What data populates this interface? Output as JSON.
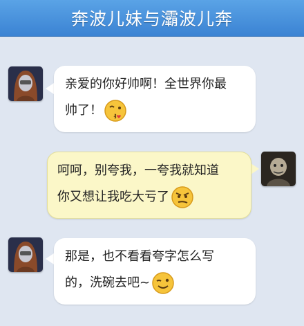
{
  "header": {
    "title": "奔波儿妹与灞波儿奔"
  },
  "messages": [
    {
      "side": "left",
      "lines": [
        "亲爱的你好帅啊！全世界你最",
        "帅了！"
      ],
      "emoji": "kiss-wink-emoji"
    },
    {
      "side": "right",
      "lines": [
        "呵呵，别夸我，一夸我就知道",
        "你又想让我吃大亏了"
      ],
      "emoji": "smirk-emoji"
    },
    {
      "side": "left",
      "lines": [
        "那是，也不看看夸字怎么写",
        "的，洗碗去吧~"
      ],
      "emoji": "wink-emoji"
    }
  ],
  "colors": {
    "header": "#3b83d3",
    "background": "#dfe6f1",
    "bubble_white": "#ffffff",
    "bubble_yellow": "#fbf7c8"
  }
}
